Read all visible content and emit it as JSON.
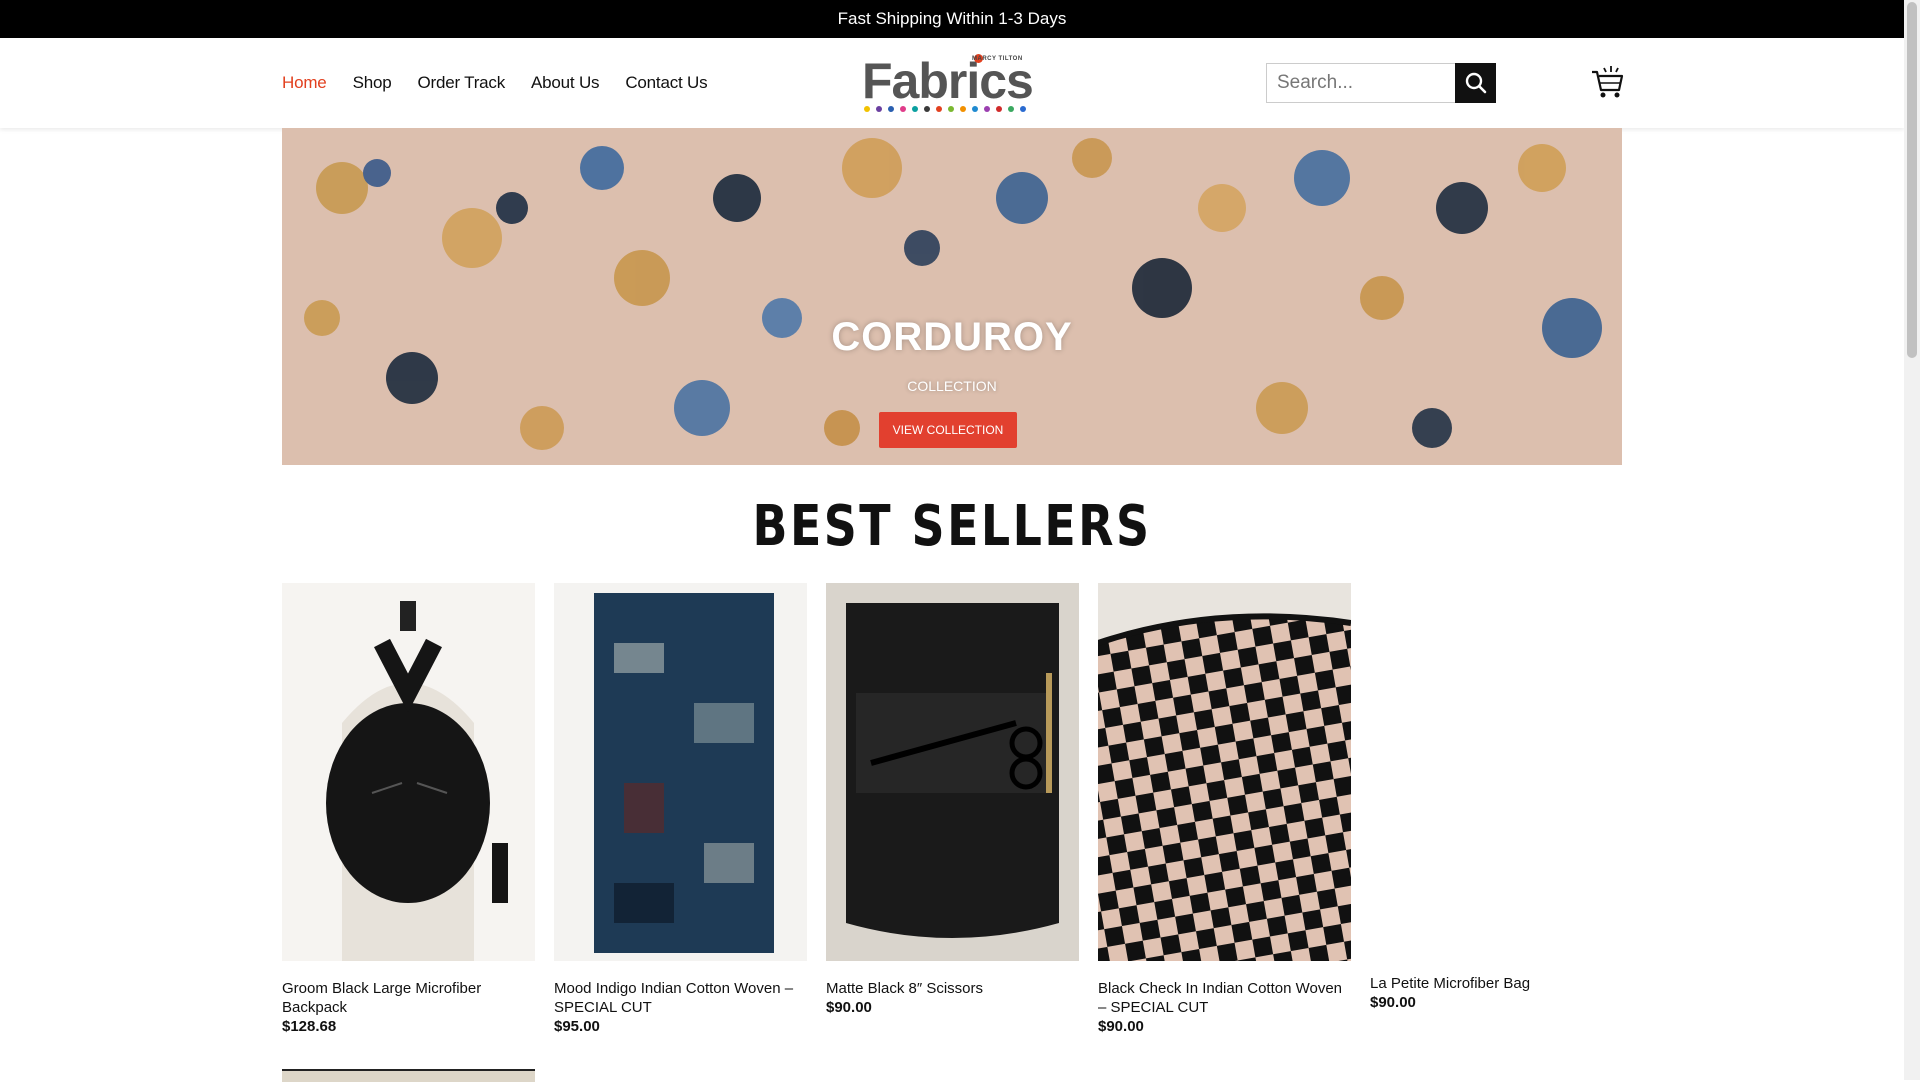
{
  "topbar": {
    "text": "Fast Shipping Within 1-3 Days"
  },
  "nav": {
    "items": [
      {
        "label": "Home",
        "active": true
      },
      {
        "label": "Shop"
      },
      {
        "label": "Order Track"
      },
      {
        "label": "About Us"
      },
      {
        "label": "Contact Us"
      }
    ]
  },
  "logo": {
    "word": "Fabrics",
    "tagline": "MARCY TILTON"
  },
  "search": {
    "placeholder": "Search..."
  },
  "hero": {
    "title": "CORDUROY",
    "subtitle": "COLLECTION",
    "button": "VIEW COLLECTION"
  },
  "section": {
    "title": "BEST SELLERS"
  },
  "products": [
    {
      "name": "Groom Black Large Microfiber Backpack",
      "price": "$128.68"
    },
    {
      "name": "Mood Indigo Indian Cotton Woven – SPECIAL CUT",
      "price": "$95.00"
    },
    {
      "name": "Matte Black 8″ Scissors",
      "price": "$90.00"
    },
    {
      "name": "Black Check In Indian Cotton Woven – SPECIAL CUT",
      "price": "$90.00"
    },
    {
      "name": "La Petite Microfiber Bag",
      "price": "$90.00"
    }
  ],
  "colors": {
    "accent": "#e2401f",
    "button": "#e2402f",
    "dark": "#111111"
  },
  "icons": {
    "search": "search-icon",
    "cart": "cart-icon"
  }
}
